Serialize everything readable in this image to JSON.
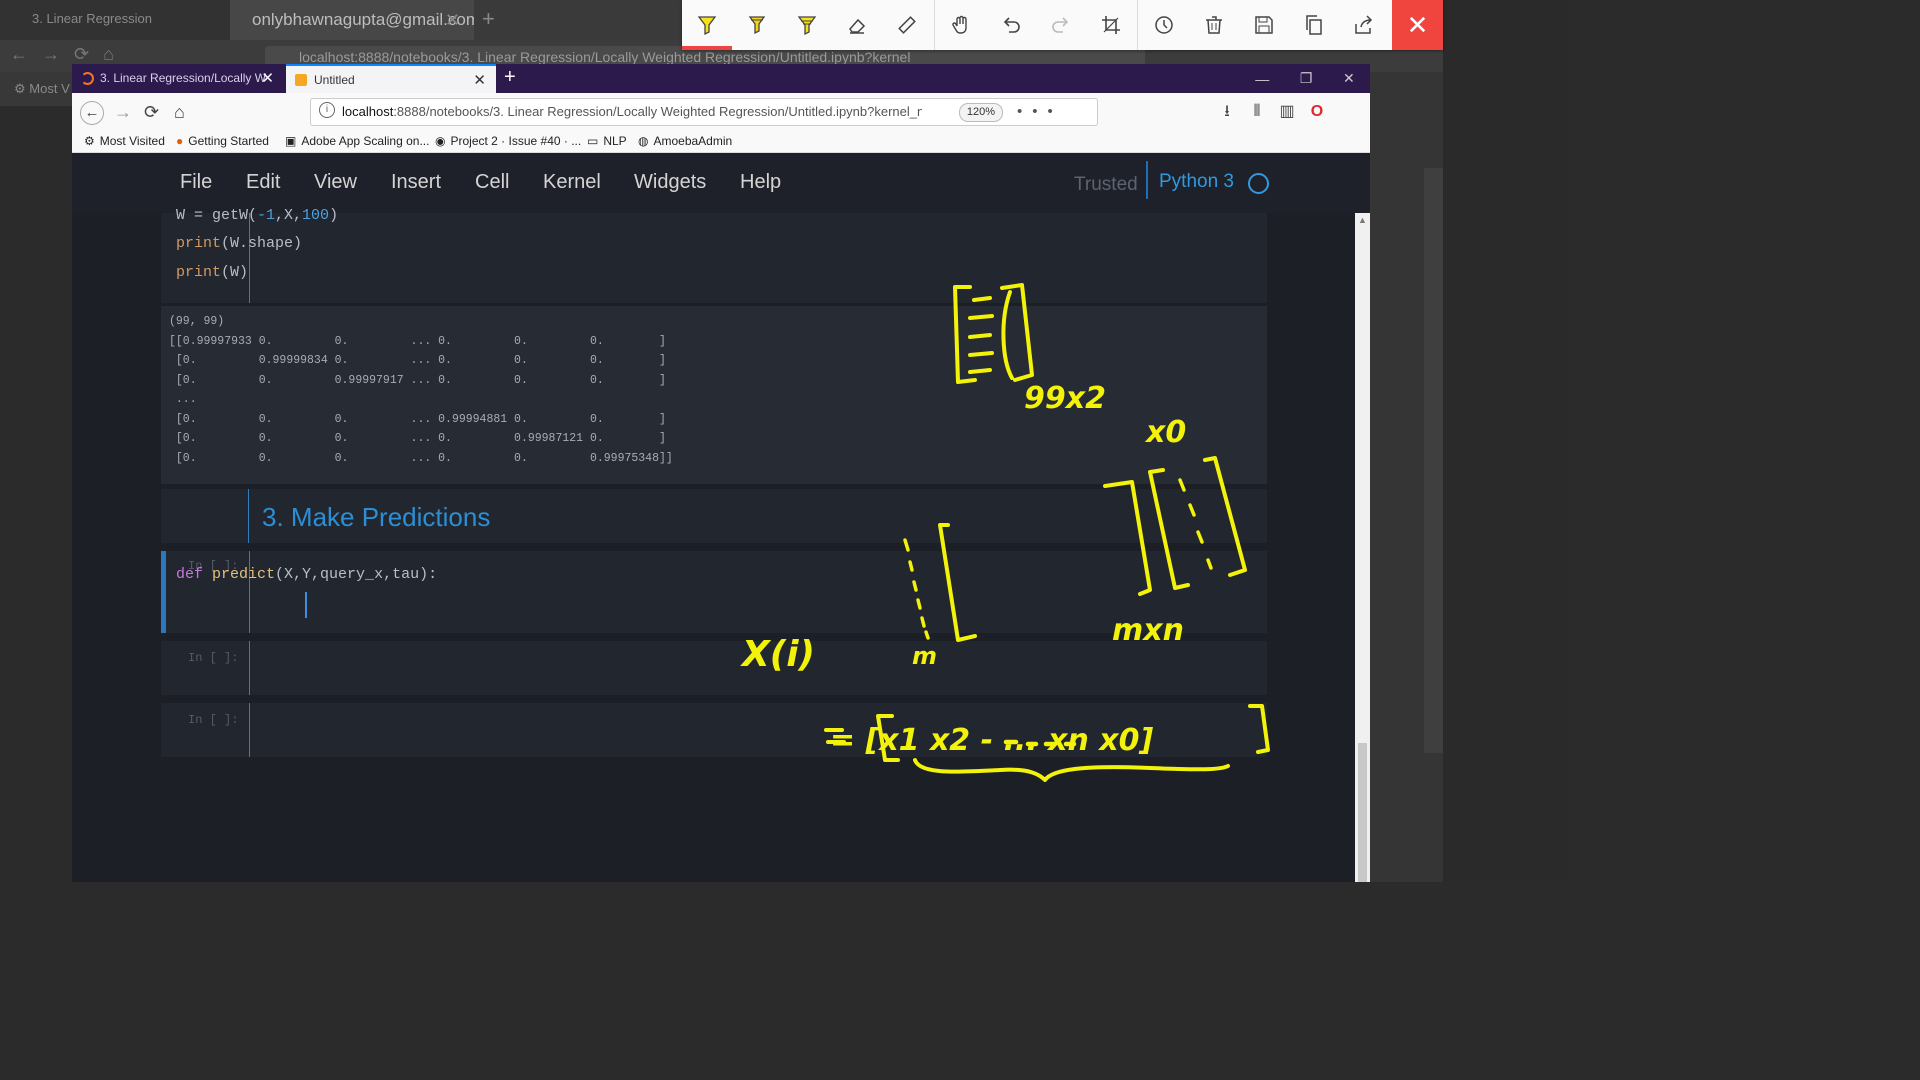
{
  "background_browser": {
    "tab1_title": "3. Linear Regression",
    "tab2_title": "onlybhawnagupta@gmail.com",
    "url": "localhost:8888/notebooks/3. Linear Regression/Locally Weighted Regression/Untitled.ipynb?kernel",
    "zoom": "120%",
    "bookmark_partial": "Most V"
  },
  "annotation_toolbar": {
    "icons": [
      "yellow-highlighter-icon",
      "yellow-pen-icon",
      "yellow-marker-icon",
      "eraser-icon",
      "ruler-icon",
      "hand-icon",
      "undo-icon",
      "redo-icon",
      "crop-icon",
      "history-icon",
      "trash-icon",
      "save-icon",
      "copy-icon",
      "share-icon"
    ],
    "close_glyph": "✕",
    "close_color": "#f0453f"
  },
  "browser": {
    "tabs": [
      {
        "title": "3. Linear Regression/Locally W",
        "close": "✕"
      },
      {
        "title": "Untitled",
        "close": "✕"
      }
    ],
    "new_tab": "+",
    "url_host": "localhost",
    "url_rest": ":8888/notebooks/3. Linear Regression/Locally Weighted Regression/Untitled.ipynb?kernel_n",
    "zoom": "120%",
    "url_more": "•••",
    "bookmarks": [
      {
        "label": "Most Visited",
        "icon": "gear-icon"
      },
      {
        "label": "Getting Started",
        "icon": "firefox-icon"
      },
      {
        "label": "Adobe App Scaling on...",
        "icon": "adobe-icon"
      },
      {
        "label": "Project 2 · Issue #40 · ...",
        "icon": "github-icon"
      },
      {
        "label": "NLP",
        "icon": "folder-icon"
      },
      {
        "label": "AmoebaAdmin",
        "icon": "globe-icon"
      }
    ]
  },
  "jupyter": {
    "menu": [
      "File",
      "Edit",
      "View",
      "Insert",
      "Cell",
      "Kernel",
      "Widgets",
      "Help"
    ],
    "trusted": "Trusted",
    "kernel": "Python 3",
    "accent": "#2a8fd6"
  },
  "cells": {
    "code1_lines": [
      {
        "a": "W = getW(",
        "n1": "-1",
        "b": ",X,",
        "n2": "100",
        "c": ")"
      },
      {
        "p": "print",
        "rest": "(W.shape)"
      },
      {
        "p": "print",
        "rest": "(W)"
      }
    ],
    "output_text": "(99, 99)\n[[0.99997933 0.         0.         ... 0.         0.         0.        ]\n [0.         0.99999834 0.         ... 0.         0.         0.        ]\n [0.         0.         0.99997917 ... 0.         0.         0.        ]\n ...\n [0.         0.         0.         ... 0.99994881 0.         0.        ]\n [0.         0.         0.         ... 0.         0.99987121 0.        ]\n [0.         0.         0.         ... 0.         0.         0.99975348]]",
    "markdown_title": "3. Make Predictions",
    "prompt_empty": "In [ ]:",
    "predict_def_kw": "def",
    "predict_name": "predict",
    "predict_args": "(X,Y,query_x,tau):"
  },
  "handwriting": {
    "ink_color": "#f2f20a",
    "labels": [
      "99x2",
      "x0",
      "X(i)",
      "m",
      "mxn",
      "= [x1 x2 - ... xn   x0]"
    ]
  }
}
